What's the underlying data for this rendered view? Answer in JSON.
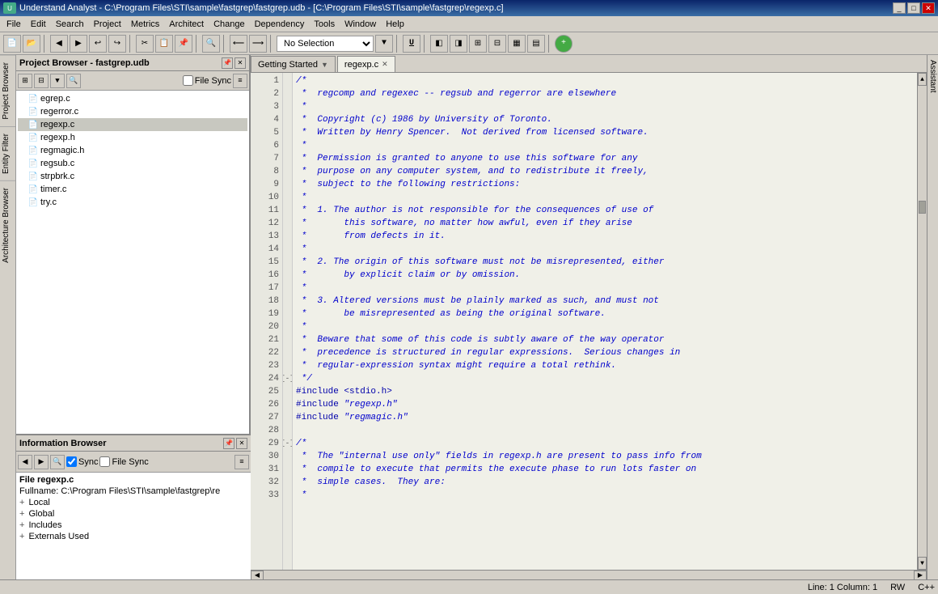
{
  "titlebar": {
    "text": "Understand Analyst - C:\\Program Files\\STI\\sample\\fastgrep\\fastgrep.udb - [C:\\Program Files\\STI\\sample\\fastgrep\\regexp.c]",
    "buttons": [
      "_",
      "□",
      "✕"
    ]
  },
  "menubar": {
    "items": [
      "File",
      "Edit",
      "Search",
      "Project",
      "Metrics",
      "Architect",
      "Change",
      "Dependency",
      "Tools",
      "Window",
      "Help"
    ]
  },
  "toolbar": {
    "no_selection_label": "No Selection"
  },
  "tabs": {
    "getting_started": "Getting Started",
    "regexp": "regexp.c"
  },
  "project_browser": {
    "title": "Project Browser - fastgrep.udb",
    "file_sync_label": "File Sync",
    "files": [
      {
        "name": "egrep.c",
        "icon": "📄"
      },
      {
        "name": "regerror.c",
        "icon": "📄"
      },
      {
        "name": "regexp.c",
        "icon": "📄",
        "selected": true
      },
      {
        "name": "regexp.h",
        "icon": "📄"
      },
      {
        "name": "regmagic.h",
        "icon": "📄"
      },
      {
        "name": "regsub.c",
        "icon": "📄"
      },
      {
        "name": "strpbrk.c",
        "icon": "📄"
      },
      {
        "name": "timer.c",
        "icon": "📄"
      },
      {
        "name": "try.c",
        "icon": "📄"
      }
    ]
  },
  "info_browser": {
    "title": "Information Browser",
    "sync_label": "Sync",
    "file_sync_label": "File Sync",
    "file_label": "File regexp.c",
    "fullname_label": "Fullname: C:\\Program Files\\STI\\sample\\fastgrep\\re",
    "local_label": "Local",
    "global_label": "Global",
    "includes_label": "Includes",
    "externals_label": "Externals Used"
  },
  "code": {
    "lines": [
      {
        "num": 1,
        "fold": "",
        "text": "/*",
        "class": "code-comment"
      },
      {
        "num": 2,
        "fold": "",
        "text": " *  regcomp and regexec -- regsub and regerror are elsewhere",
        "class": "code-comment"
      },
      {
        "num": 3,
        "fold": "",
        "text": " *",
        "class": "code-comment"
      },
      {
        "num": 4,
        "fold": "",
        "text": " *  Copyright (c) 1986 by University of Toronto.",
        "class": "code-comment"
      },
      {
        "num": 5,
        "fold": "",
        "text": " *  Written by Henry Spencer.  Not derived from licensed software.",
        "class": "code-comment"
      },
      {
        "num": 6,
        "fold": "",
        "text": " *",
        "class": "code-comment"
      },
      {
        "num": 7,
        "fold": "",
        "text": " *  Permission is granted to anyone to use this software for any",
        "class": "code-comment"
      },
      {
        "num": 8,
        "fold": "",
        "text": " *  purpose on any computer system, and to redistribute it freely,",
        "class": "code-comment"
      },
      {
        "num": 9,
        "fold": "",
        "text": " *  subject to the following restrictions:",
        "class": "code-comment"
      },
      {
        "num": 10,
        "fold": "",
        "text": " *",
        "class": "code-comment"
      },
      {
        "num": 11,
        "fold": "",
        "text": " *  1. The author is not responsible for the consequences of use of",
        "class": "code-comment"
      },
      {
        "num": 12,
        "fold": "",
        "text": " *       this software, no matter how awful, even if they arise",
        "class": "code-comment"
      },
      {
        "num": 13,
        "fold": "",
        "text": " *       from defects in it.",
        "class": "code-comment"
      },
      {
        "num": 14,
        "fold": "",
        "text": " *",
        "class": "code-comment"
      },
      {
        "num": 15,
        "fold": "",
        "text": " *  2. The origin of this software must not be misrepresented, either",
        "class": "code-comment"
      },
      {
        "num": 16,
        "fold": "",
        "text": " *       by explicit claim or by omission.",
        "class": "code-comment"
      },
      {
        "num": 17,
        "fold": "",
        "text": " *",
        "class": "code-comment"
      },
      {
        "num": 18,
        "fold": "",
        "text": " *  3. Altered versions must be plainly marked as such, and must not",
        "class": "code-comment"
      },
      {
        "num": 19,
        "fold": "",
        "text": " *       be misrepresented as being the original software.",
        "class": "code-comment"
      },
      {
        "num": 20,
        "fold": "",
        "text": " *",
        "class": "code-comment"
      },
      {
        "num": 21,
        "fold": "",
        "text": " *  Beware that some of this code is subtly aware of the way operator",
        "class": "code-comment"
      },
      {
        "num": 22,
        "fold": "",
        "text": " *  precedence is structured in regular expressions.  Serious changes in",
        "class": "code-comment"
      },
      {
        "num": 23,
        "fold": "",
        "text": " *  regular-expression syntax might require a total rethink.",
        "class": "code-comment"
      },
      {
        "num": 24,
        "fold": "-",
        "text": " */",
        "class": "code-comment"
      },
      {
        "num": 25,
        "fold": "",
        "text": "#include <stdio.h>",
        "class": "code-include"
      },
      {
        "num": 26,
        "fold": "",
        "text": "#include \"regexp.h\"",
        "class": "code-include"
      },
      {
        "num": 27,
        "fold": "",
        "text": "#include \"regmagic.h\"",
        "class": "code-include"
      },
      {
        "num": 28,
        "fold": "",
        "text": "",
        "class": "code-comment"
      },
      {
        "num": 29,
        "fold": "-",
        "text": "/*",
        "class": "code-comment"
      },
      {
        "num": 30,
        "fold": "",
        "text": " *  The \"internal use only\" fields in regexp.h are present to pass info from",
        "class": "code-comment"
      },
      {
        "num": 31,
        "fold": "",
        "text": " *  compile to execute that permits the execute phase to run lots faster on",
        "class": "code-comment"
      },
      {
        "num": 32,
        "fold": "",
        "text": " *  simple cases.  They are:",
        "class": "code-comment"
      },
      {
        "num": 33,
        "fold": "",
        "text": " *",
        "class": "code-comment"
      }
    ]
  },
  "statusbar": {
    "line_col": "Line: 1  Column: 1",
    "mode": "RW",
    "lang": "C++"
  }
}
